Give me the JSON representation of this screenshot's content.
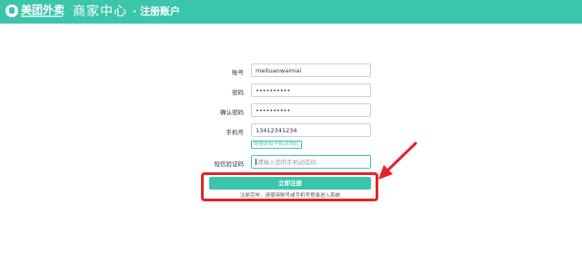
{
  "header": {
    "logo_text": "美团外卖",
    "brand_title": "商家中心",
    "page_title": "· 注册账户",
    "color": "#3bc5ab"
  },
  "form": {
    "account_label": "账号",
    "account_value": "meituanwaimai",
    "password_label": "密码",
    "password_value": "••••••••••",
    "confirm_label": "确认密码",
    "confirm_value": "••••••••••",
    "phone_label": "手机号",
    "phone_value": "13412341234",
    "send_code_label": "免费获取手机动态码",
    "sms_label": "短信验证码",
    "sms_placeholder": "请输入您的手机动态码",
    "submit_label": "立即注册",
    "note": "注册完毕，请使用账号或手机号登录进入系统"
  },
  "annotation": {
    "highlight_color": "#e8202a"
  }
}
